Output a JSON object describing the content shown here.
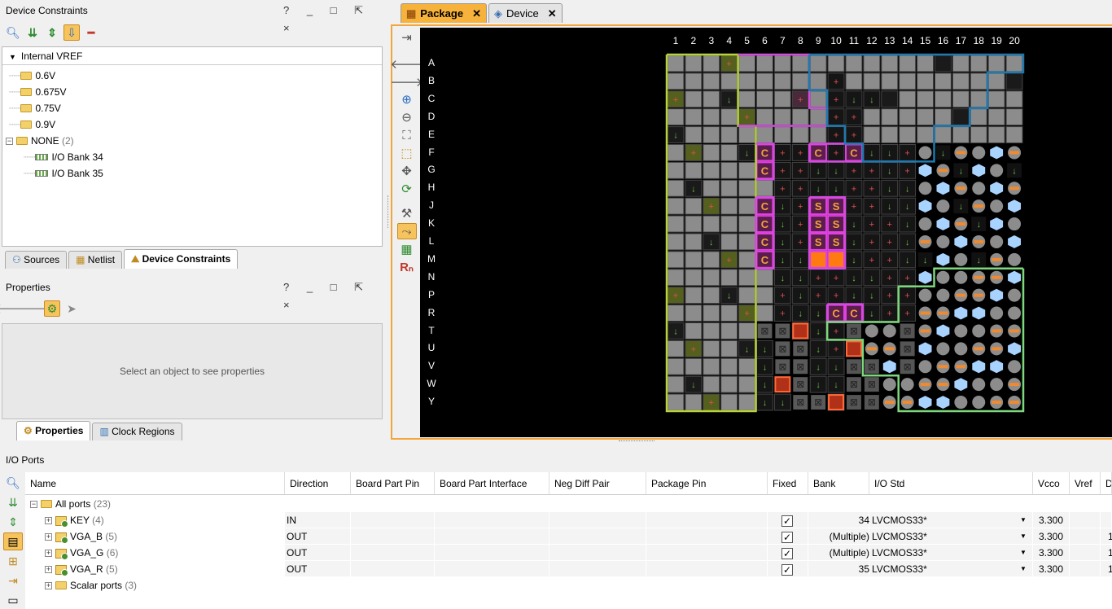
{
  "device_constraints": {
    "title": "Device Constraints",
    "window_buttons": "? _ □ ⇱ ×",
    "tree_header": "Internal VREF",
    "items": [
      {
        "label": "0.6V"
      },
      {
        "label": "0.675V"
      },
      {
        "label": "0.75V"
      },
      {
        "label": "0.9V"
      },
      {
        "label": "NONE",
        "count": "(2)"
      }
    ],
    "children": [
      {
        "label": "I/O Bank 34"
      },
      {
        "label": "I/O Bank 35"
      }
    ],
    "tabs": [
      "Sources",
      "Netlist",
      "Device Constraints"
    ]
  },
  "properties": {
    "title": "Properties",
    "window_buttons": "? _ □ ⇱ ×",
    "placeholder": "Select an object to see properties",
    "tabs": [
      "Properties",
      "Clock Regions"
    ]
  },
  "documents": {
    "tabs": [
      {
        "label": "Package",
        "active": true
      },
      {
        "label": "Device",
        "active": false
      }
    ]
  },
  "package": {
    "columns": [
      "1",
      "2",
      "3",
      "4",
      "5",
      "6",
      "7",
      "8",
      "9",
      "10",
      "11",
      "12",
      "13",
      "14",
      "15",
      "16",
      "17",
      "18",
      "19",
      "20"
    ],
    "rows": [
      "A",
      "B",
      "C",
      "D",
      "E",
      "F",
      "G",
      "H",
      "J",
      "K",
      "L",
      "M",
      "N",
      "P",
      "R",
      "T",
      "U",
      "V",
      "W",
      "Y"
    ],
    "clock_pin_letter": "C",
    "special_pin_letter": "S",
    "colors": {
      "bank_35_outline": "#b7d33a",
      "bank_34_outline": "#d44adf",
      "bank_15_outline": "#1f79b0",
      "bank_13_outline": "#7dd87d",
      "pin_grey": "#8c8c8c",
      "accent": "#f3a43a"
    }
  },
  "io_ports": {
    "title": "I/O Ports",
    "columns": [
      "Name",
      "Direction",
      "Board Part Pin",
      "Board Part Interface",
      "Neg Diff Pair",
      "Package Pin",
      "Fixed",
      "Bank",
      "I/O Std",
      "Vcco",
      "Vref",
      "D"
    ],
    "root": {
      "label": "All ports",
      "count": "(23)"
    },
    "rows": [
      {
        "name": "KEY",
        "count": "(4)",
        "direction": "IN",
        "fixed": "✓",
        "bank": "34",
        "iostd": "LVCMOS33*",
        "vcco": "3.300",
        "extra": ""
      },
      {
        "name": "VGA_B",
        "count": "(5)",
        "direction": "OUT",
        "fixed": "✓",
        "bank": "(Multiple)",
        "iostd": "LVCMOS33*",
        "vcco": "3.300",
        "extra": "1"
      },
      {
        "name": "VGA_G",
        "count": "(6)",
        "direction": "OUT",
        "fixed": "✓",
        "bank": "(Multiple)",
        "iostd": "LVCMOS33*",
        "vcco": "3.300",
        "extra": "1"
      },
      {
        "name": "VGA_R",
        "count": "(5)",
        "direction": "OUT",
        "fixed": "✓",
        "bank": "35",
        "iostd": "LVCMOS33*",
        "vcco": "3.300",
        "extra": "1"
      }
    ],
    "scalar": {
      "label": "Scalar ports",
      "count": "(3)"
    }
  }
}
